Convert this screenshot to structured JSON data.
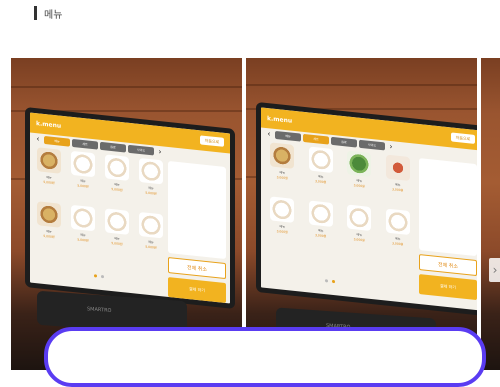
{
  "header": {
    "title": "메뉴"
  },
  "kiosk": {
    "brand": "k.menu",
    "top_button": "처음으로",
    "tabs_slide1": [
      "메뉴",
      "세트",
      "음료",
      "사이드"
    ],
    "tabs_slide2": [
      "메뉴",
      "세트",
      "음료",
      "사이드"
    ],
    "cancel_label": "전체 취소",
    "pay_label": "결제 하기",
    "items_slide1": [
      {
        "name": "메뉴",
        "price": "5,000원",
        "style": "warm"
      },
      {
        "name": "메뉴",
        "price": "5,000원",
        "style": "plain"
      },
      {
        "name": "메뉴",
        "price": "5,000원",
        "style": "plain"
      },
      {
        "name": "메뉴",
        "price": "5,000원",
        "style": "plain"
      },
      {
        "name": "메뉴",
        "price": "5,000원",
        "style": "warm"
      },
      {
        "name": "메뉴",
        "price": "5,000원",
        "style": "plain"
      },
      {
        "name": "메뉴",
        "price": "5,000원",
        "style": "plain"
      },
      {
        "name": "메뉴",
        "price": "5,000원",
        "style": "plain"
      }
    ],
    "items_slide2": [
      {
        "name": "메뉴",
        "price": "3,000원",
        "style": "warm"
      },
      {
        "name": "메뉴",
        "price": "3,000원",
        "style": "plain"
      },
      {
        "name": "메뉴",
        "price": "3,000원",
        "style": "green"
      },
      {
        "name": "메뉴",
        "price": "3,000원",
        "style": "red"
      },
      {
        "name": "메뉴",
        "price": "3,000원",
        "style": "plain"
      },
      {
        "name": "메뉴",
        "price": "3,000원",
        "style": "plain"
      },
      {
        "name": "메뉴",
        "price": "3,000원",
        "style": "plain"
      },
      {
        "name": "메뉴",
        "price": "3,000원",
        "style": "plain"
      }
    ],
    "reader_label": "SMARTRO"
  },
  "gallery": {
    "next_icon": "chevron-right-icon"
  }
}
